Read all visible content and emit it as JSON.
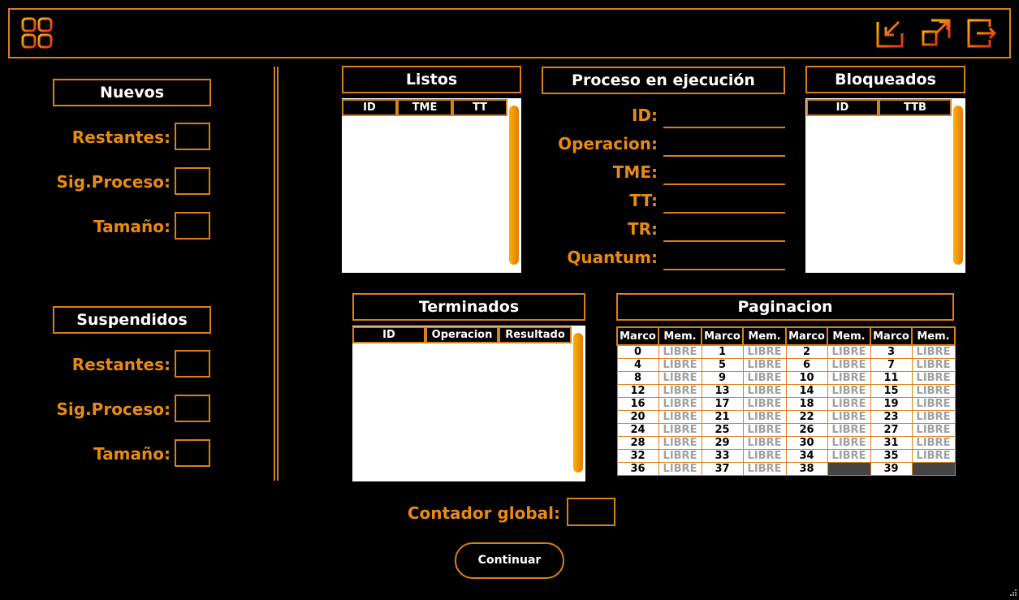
{
  "nuevos": {
    "title": "Nuevos",
    "restantes": "Restantes:",
    "sig_proceso": "Sig.Proceso:",
    "tamano": "Tamaño:"
  },
  "suspendidos": {
    "title": "Suspendidos",
    "restantes": "Restantes:",
    "sig_proceso": "Sig.Proceso:",
    "tamano": "Tamaño:"
  },
  "listos": {
    "title": "Listos",
    "columns": [
      "ID",
      "TME",
      "TT"
    ]
  },
  "ejecucion": {
    "title": "Proceso en ejecución",
    "fields": [
      "ID:",
      "Operacion:",
      "TME:",
      "TT:",
      "TR:",
      "Quantum:"
    ]
  },
  "bloqueados": {
    "title": "Bloqueados",
    "columns": [
      "ID",
      "TTB"
    ]
  },
  "terminados": {
    "title": "Terminados",
    "columns": [
      "ID",
      "Operacion",
      "Resultado"
    ]
  },
  "paginacion": {
    "title": "Paginacion",
    "header": [
      "Marco",
      "Mem.",
      "Marco",
      "Mem.",
      "Marco",
      "Mem.",
      "Marco",
      "Mem."
    ],
    "free_label": "LIBRE",
    "rows": [
      [
        0,
        1,
        2,
        3
      ],
      [
        4,
        5,
        6,
        7
      ],
      [
        8,
        9,
        10,
        11
      ],
      [
        12,
        13,
        14,
        15
      ],
      [
        16,
        17,
        18,
        19
      ],
      [
        20,
        21,
        22,
        23
      ],
      [
        24,
        25,
        26,
        27
      ],
      [
        28,
        29,
        30,
        31
      ],
      [
        32,
        33,
        34,
        35
      ],
      [
        36,
        37,
        38,
        39
      ]
    ],
    "occupied": [
      38,
      39
    ]
  },
  "contador_global": "Contador global:",
  "continuar": "Continuar",
  "icons": {
    "menu": "grid-icon",
    "minimize": "minimize-icon",
    "maximize": "maximize-icon",
    "exit": "exit-icon"
  },
  "colors": {
    "accent": "#d9801a",
    "label": "#e88a14",
    "background": "#000000"
  }
}
